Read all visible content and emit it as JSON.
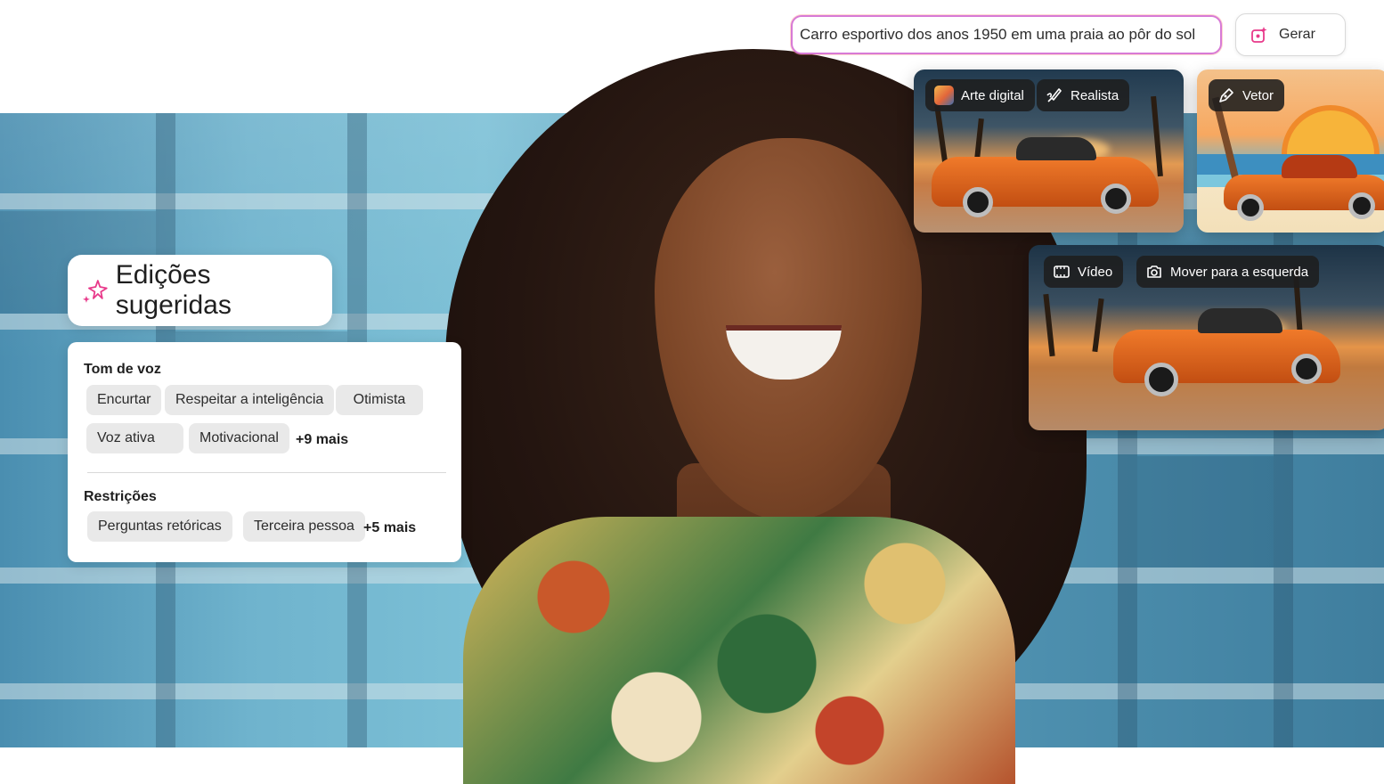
{
  "prompt": {
    "text": "Carro esportivo dos anos 1950 em uma praia ao pôr do sol"
  },
  "generate_button": {
    "label": "Gerar",
    "icon": "sparkle-image-icon"
  },
  "image_cards": [
    {
      "tags": [
        {
          "label": "Arte digital",
          "icon": "thumbnail-icon"
        },
        {
          "label": "Realista",
          "icon": "brush-icon"
        }
      ]
    },
    {
      "tags": [
        {
          "label": "Vetor",
          "icon": "pen-icon"
        }
      ]
    },
    {
      "tags": [
        {
          "label": "Vídeo",
          "icon": "film-icon"
        },
        {
          "label": "Mover para a esquerda",
          "icon": "camera-icon"
        }
      ]
    }
  ],
  "suggested_edits": {
    "title": "Edições sugeridas",
    "icon": "sparkle-icon",
    "sections": [
      {
        "title": "Tom de voz",
        "chips": [
          "Encurtar",
          "Respeitar a inteligência",
          "Otimista",
          "Voz ativa",
          "Motivacional"
        ],
        "more": "+9 mais"
      },
      {
        "title": "Restrições",
        "chips": [
          "Perguntas retóricas",
          "Terceira pessoa"
        ],
        "more": "+5 mais"
      }
    ]
  },
  "colors": {
    "prompt_border": "#d77ad6",
    "accent_sparkle": "#e8398a",
    "tag_background": "#1e1e1e"
  }
}
